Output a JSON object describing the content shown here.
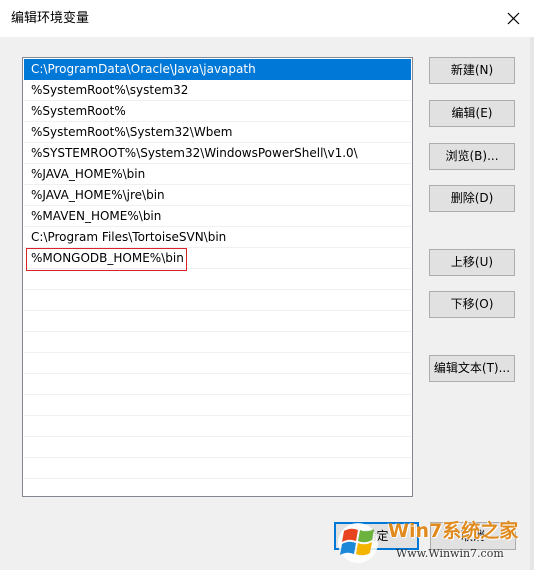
{
  "window": {
    "title": "编辑环境变量",
    "close_icon": "close-icon"
  },
  "path_list": {
    "selected_index": 0,
    "highlighted_index": 8,
    "items": [
      "C:\\ProgramData\\Oracle\\Java\\javapath",
      "%SystemRoot%\\system32",
      "%SystemRoot%",
      "%SystemRoot%\\System32\\Wbem",
      "%SYSTEMROOT%\\System32\\WindowsPowerShell\\v1.0\\",
      "%JAVA_HOME%\\bin",
      "%JAVA_HOME%\\jre\\bin",
      "%MAVEN_HOME%\\bin",
      "C:\\Program Files\\TortoiseSVN\\bin",
      "%MONGODB_HOME%\\bin"
    ]
  },
  "buttons": {
    "new": "新建(N)",
    "edit": "编辑(E)",
    "browse": "浏览(B)...",
    "delete": "删除(D)",
    "move_up": "上移(U)",
    "move_down": "下移(O)",
    "edit_text": "编辑文本(T)...",
    "ok": "确定",
    "cancel": "取消"
  },
  "watermark": {
    "brand": "Win7系统之家",
    "url": "Www.Winwin7.com"
  },
  "colors": {
    "selection": "#0078d7",
    "highlight_border": "#d9232b",
    "dialog_bg": "#f0f0f0"
  }
}
